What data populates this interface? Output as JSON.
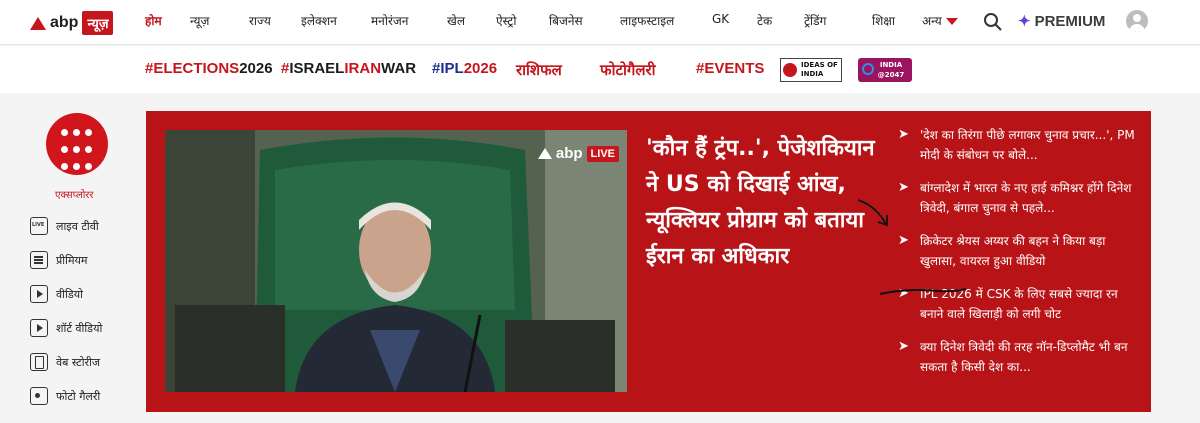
{
  "brand": {
    "abp": "abp",
    "news": "न्यूज़"
  },
  "nav": {
    "items": [
      "होम",
      "न्यूज़",
      "राज्य",
      "इलेक्शन",
      "मनोरंजन",
      "खेल",
      "ऐस्ट्रो",
      "बिजनेस",
      "लाइफस्टाइल",
      "GK",
      "टेक",
      "ट्रेंडिंग",
      "शिक्षा"
    ],
    "more": "अन्य",
    "premium": "PREMIUM",
    "active_color": "#c4161c"
  },
  "tags": {
    "elections_hash": "#",
    "elections": "ELECTIONS",
    "elections_year": "2026",
    "israel_hash": "#",
    "israel_a": "ISRAEL",
    "israel_b": "IRAN",
    "israel_c": "WAR",
    "ipl_hash": "#",
    "ipl": "IPL",
    "ipl_year": "2026",
    "rashifal": "राशिफल",
    "photogallery": "फोटोगैलरी",
    "events": "#EVENTS",
    "ideas_line1": "IDEAS OF",
    "ideas_line2": "INDIA",
    "india_badge_line1": "INDIA",
    "india_badge_line2": "@2047"
  },
  "sidebar": {
    "explorer": "एक्सप्लोरर",
    "items": [
      {
        "label": "लाइव टीवी",
        "icon": "live-tv-icon"
      },
      {
        "label": "प्रीमियम",
        "icon": "premium-doc-icon"
      },
      {
        "label": "वीडियो",
        "icon": "video-play-icon"
      },
      {
        "label": "शॉर्ट वीडियो",
        "icon": "short-video-icon"
      },
      {
        "label": "वेब स्टोरीज",
        "icon": "web-stories-icon"
      },
      {
        "label": "फोटो गैलरी",
        "icon": "photo-gallery-icon"
      }
    ]
  },
  "hero": {
    "badge_abp": "abp",
    "badge_live": "LIVE",
    "headline": "'कौन हैं ट्रंप..', पेजेशकियान ने US को दिखाई आंख, न्यूक्लियर प्रोग्राम को बताया ईरान का अधिकार",
    "bg_color": "#b81418",
    "related": [
      "'देश का तिरंगा पीछे लगाकर चुनाव प्रचार...', PM मोदी के संबोधन पर बोले...",
      "बांग्लादेश में भारत के नए हाई कमिश्नर होंगे दिनेश त्रिवेदी, बंगाल चुनाव से पहले...",
      "क्रिकेटर श्रेयस अय्यर की बहन ने किया बड़ा खुलासा, वायरल हुआ वीडियो",
      "IPL 2026 में CSK के लिए सबसे ज्यादा रन बनाने वाले खिलाड़ी को लगी चोट",
      "क्या दिनेश त्रिवेदी की तरह नॉन-डिप्लोमैट भी बन सकता है किसी देश का..."
    ]
  }
}
